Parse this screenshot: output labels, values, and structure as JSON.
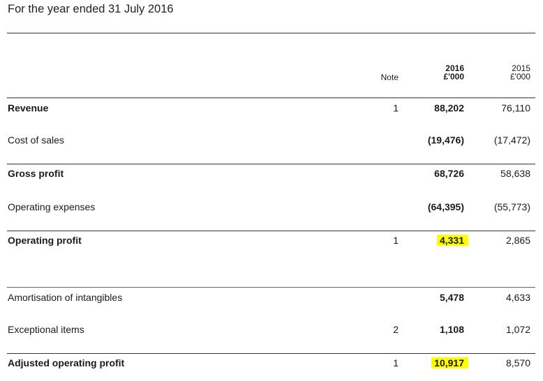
{
  "title": "For the year ended 31 July 2016",
  "header": {
    "note": "Note",
    "current_year": "2016",
    "current_unit": "£'000",
    "prior_year": "2015",
    "prior_unit": "£'000"
  },
  "rows": [
    {
      "label": "Revenue",
      "note": "1",
      "current": "88,202",
      "prior": "76,110"
    },
    {
      "label": "Cost of sales",
      "note": "",
      "current": "(19,476)",
      "prior": "(17,472)"
    },
    {
      "label": "Gross profit",
      "note": "",
      "current": "68,726",
      "prior": "58,638"
    },
    {
      "label": "Operating expenses",
      "note": "",
      "current": "(64,395)",
      "prior": "(55,773)"
    },
    {
      "label": "Operating profit",
      "note": "1",
      "current": "4,331",
      "prior": "2,865"
    },
    {
      "label": "Amortisation of intangibles",
      "note": "",
      "current": "5,478",
      "prior": "4,633"
    },
    {
      "label": "Exceptional items",
      "note": "2",
      "current": "1,108",
      "prior": "1,072"
    },
    {
      "label": "Adjusted operating profit",
      "note": "1",
      "current": "10,917",
      "prior": "8,570"
    }
  ],
  "highlight_color": "#ffff00"
}
